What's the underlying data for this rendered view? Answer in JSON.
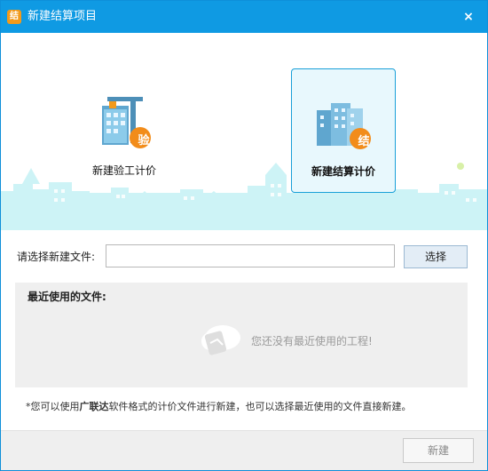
{
  "window": {
    "title": "新建结算项目",
    "icon_glyph": "结",
    "close_glyph": "×",
    "accent_color": "#0f9ae3"
  },
  "options": [
    {
      "label": "新建验工计价",
      "badge": "验",
      "icon": "building-crane-icon",
      "selected": false
    },
    {
      "label": "新建结算计价",
      "badge": "结",
      "icon": "building-blocks-icon",
      "selected": true
    }
  ],
  "file_picker": {
    "label": "请选择新建文件:",
    "value": "",
    "button_label": "选择"
  },
  "recent": {
    "title": "最近使用的文件:",
    "empty_text": "您还没有最近使用的工程!"
  },
  "hint": {
    "prefix": "*您可以使用",
    "brand": "广联达",
    "suffix": "软件格式的计价文件进行新建，也可以选择最近使用的文件直接新建。"
  },
  "footer": {
    "new_label": "新建"
  }
}
